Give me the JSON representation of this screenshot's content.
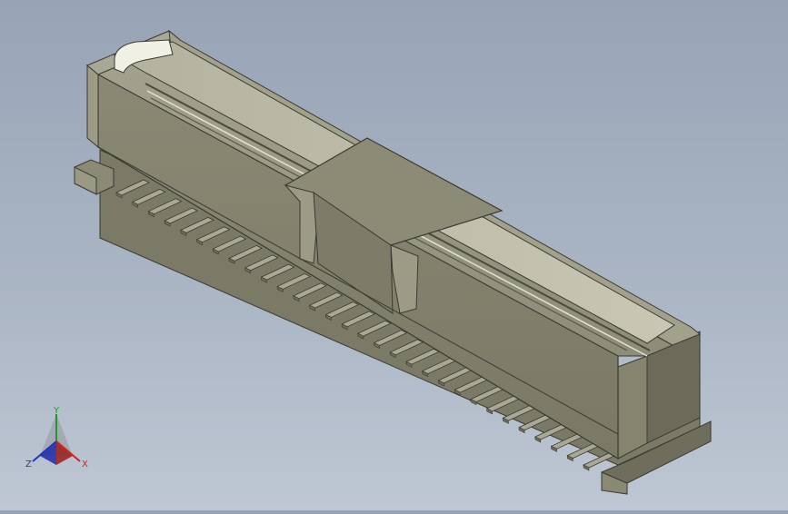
{
  "viewport": {
    "background_top": "#97a4b6",
    "background_bottom": "#bec7d3",
    "model": {
      "body_color": "#8c8b76",
      "face_light": "#9a9984",
      "face_mid": "#85846f",
      "face_dark": "#6f6e5c",
      "edge_color": "#3a3a32",
      "pin_count": 30
    }
  },
  "triad": {
    "x_label": "X",
    "y_label": "Y",
    "z_label": "Z",
    "x_color": "#d62020",
    "y_color": "#1f9a2a",
    "z_color": "#2036c8"
  }
}
